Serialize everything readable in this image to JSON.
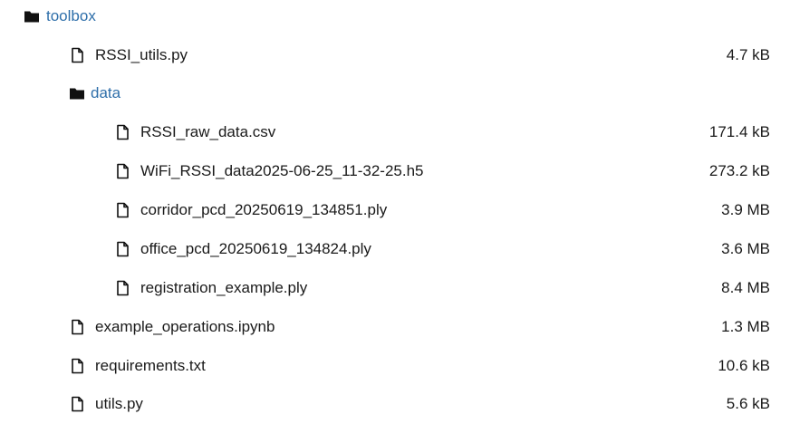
{
  "tree": {
    "root": {
      "name": "toolbox",
      "icon": "folder-icon"
    },
    "rssi_utils": {
      "name": "RSSI_utils.py",
      "size": "4.7 kB",
      "icon": "file-icon"
    },
    "data_folder": {
      "name": "data",
      "icon": "folder-icon"
    },
    "data_files": [
      {
        "name": "RSSI_raw_data.csv",
        "size": "171.4 kB",
        "icon": "file-icon"
      },
      {
        "name": "WiFi_RSSI_data2025-06-25_11-32-25.h5",
        "size": "273.2 kB",
        "icon": "file-icon"
      },
      {
        "name": "corridor_pcd_20250619_134851.ply",
        "size": "3.9 MB",
        "icon": "file-icon"
      },
      {
        "name": "office_pcd_20250619_134824.ply",
        "size": "3.6 MB",
        "icon": "file-icon"
      },
      {
        "name": "registration_example.ply",
        "size": "8.4 MB",
        "icon": "file-icon"
      }
    ],
    "root_files": [
      {
        "name": "example_operations.ipynb",
        "size": "1.3 MB",
        "icon": "file-icon"
      },
      {
        "name": "requirements.txt",
        "size": "10.6 kB",
        "icon": "file-icon"
      },
      {
        "name": "utils.py",
        "size": "5.6 kB",
        "icon": "file-icon"
      }
    ]
  },
  "colors": {
    "folder_link": "#2f6faa",
    "text": "#1a1a1a"
  }
}
